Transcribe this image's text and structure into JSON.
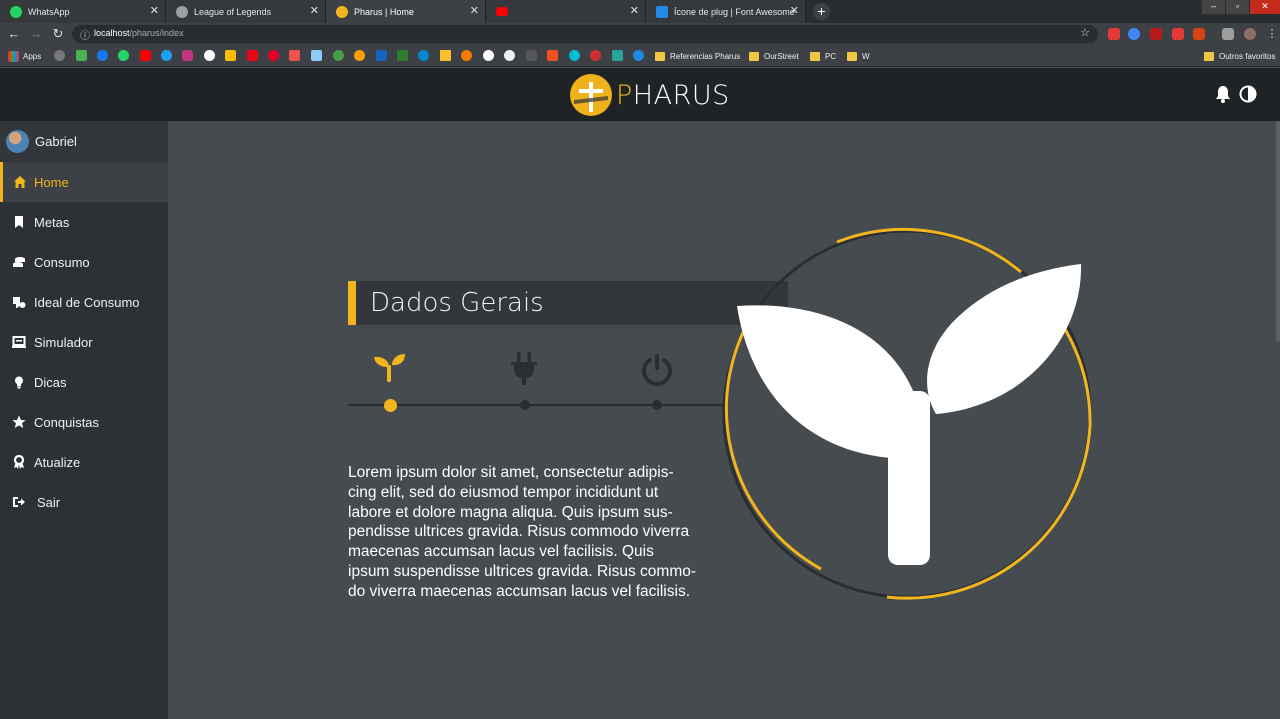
{
  "browser": {
    "tabs": [
      {
        "title": "WhatsApp",
        "color": "#25d366"
      },
      {
        "title": "League of Legends",
        "color": "#9aa0a6"
      },
      {
        "title": "Pharus | Home",
        "color": "#f2b51e"
      },
      {
        "title": "",
        "color": "#ff0000"
      },
      {
        "title": "Ícone de plug | Font Awesome",
        "color": "#228ae6"
      }
    ],
    "active_tab": 2,
    "url_host": "localhost",
    "url_path": "/pharus/index",
    "bookmarks": {
      "apps_label": "Apps",
      "folders": [
        "Referencias Pharus",
        "OurStreet",
        "PC",
        "W"
      ],
      "other": "Outros favoritos"
    }
  },
  "app": {
    "brand_prefix": "P",
    "brand_rest": "HARUS",
    "accent_color": "#f2b51e",
    "user": {
      "name": "Gabriel"
    },
    "menu": [
      {
        "label": "Home",
        "icon": "home-icon",
        "active": true
      },
      {
        "label": "Metas",
        "icon": "bookmark-icon"
      },
      {
        "label": "Consumo",
        "icon": "coins-icon"
      },
      {
        "label": "Ideal de Consumo",
        "icon": "plug-icon"
      },
      {
        "label": "Simulador",
        "icon": "monitor-icon"
      },
      {
        "label": "Dicas",
        "icon": "lightbulb-icon"
      },
      {
        "label": "Conquistas",
        "icon": "star-icon"
      },
      {
        "label": "Atualize",
        "icon": "award-icon"
      },
      {
        "label": "Sair",
        "icon": "sign-out-icon"
      }
    ],
    "section_title": "Dados Gerais",
    "steps": [
      {
        "icon": "seedling-icon",
        "active": true
      },
      {
        "icon": "plug-icon",
        "active": false
      },
      {
        "icon": "power-icon",
        "active": false
      }
    ],
    "body_lines": [
      "Lorem ipsum dolor sit amet, consectetur adipis-",
      "cing elit, sed do eiusmod tempor incididunt ut",
      "labore et dolore magna aliqua. Quis ipsum sus-",
      "pendisse ultrices gravida. Risus commodo viverra",
      "maecenas accumsan lacus vel facilisis. Quis",
      "ipsum suspendisse ultrices gravida. Risus commo-",
      "do viverra maecenas accumsan lacus vel facilisis."
    ]
  }
}
